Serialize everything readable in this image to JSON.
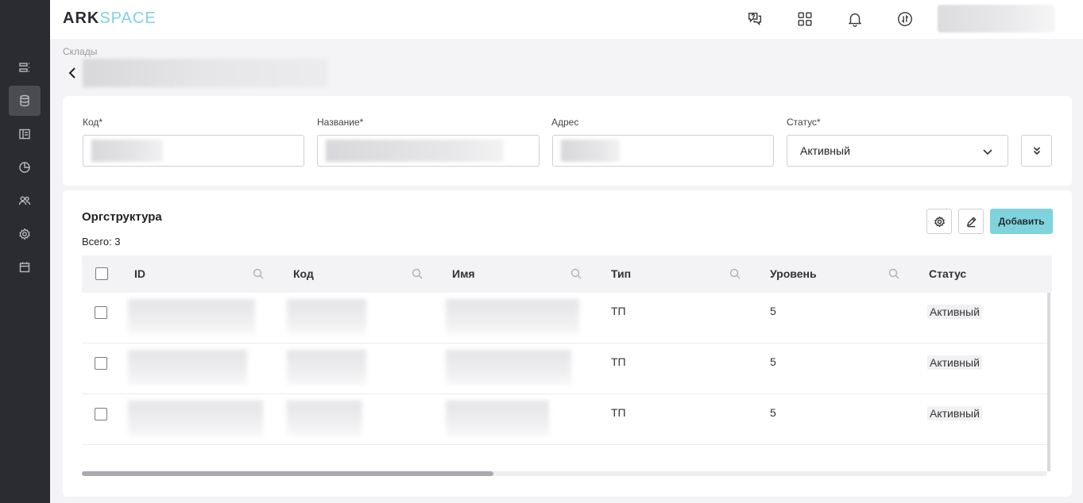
{
  "app": {
    "logo_ark": "ARK",
    "logo_space": "SPACE"
  },
  "breadcrumb": "Склады",
  "form": {
    "code_label": "Код*",
    "name_label": "Название*",
    "address_label": "Адрес",
    "status_label": "Статус*",
    "status_value": "Активный"
  },
  "table": {
    "title": "Оргструктура",
    "total": "Всего: 3",
    "add_label": "Добавить",
    "columns": [
      "ID",
      "Код",
      "Имя",
      "Тип",
      "Уровень",
      "Статус"
    ],
    "rows": [
      {
        "type": "ТП",
        "level": "5",
        "status": "Активный"
      },
      {
        "type": "ТП",
        "level": "5",
        "status": "Активный"
      },
      {
        "type": "ТП",
        "level": "5",
        "status": "Активный"
      }
    ]
  },
  "icons": {
    "sidebar": [
      "list-icon",
      "database-icon",
      "layout-icon",
      "chart-icon",
      "users-icon",
      "gear-icon",
      "calendar-icon"
    ],
    "topbar": [
      "chat-icon",
      "apps-grid-icon",
      "bell-icon",
      "sync-icon"
    ]
  },
  "colors": {
    "accent": "#7fd3dc",
    "sidebar": "#2b2c31"
  },
  "scroll": {
    "horizontal_position": 0.43
  }
}
